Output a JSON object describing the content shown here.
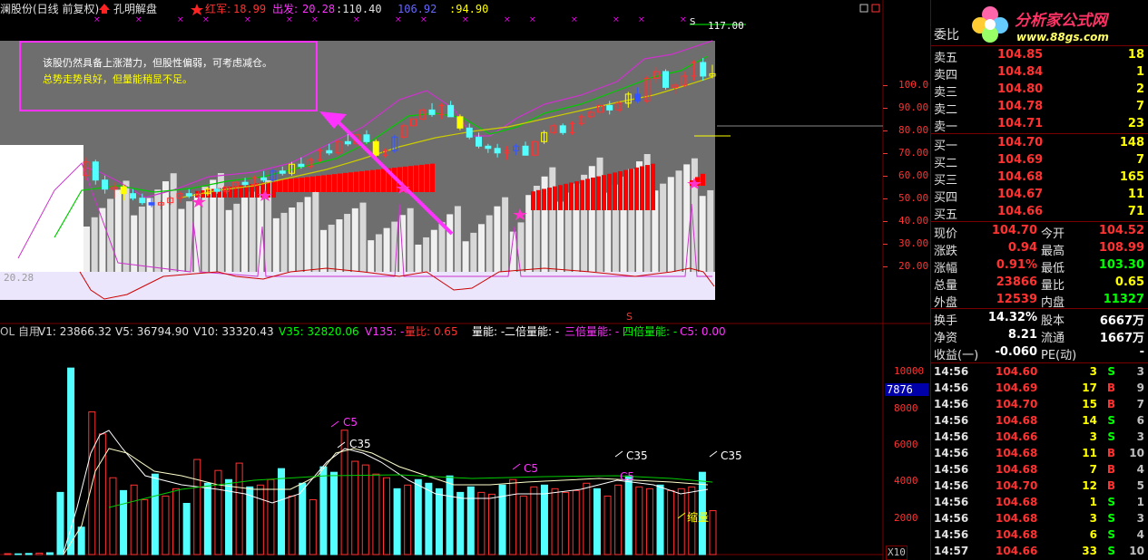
{
  "colors": {
    "up": "#ff3232",
    "down": "#54ffff",
    "yellow": "#ffff00",
    "green": "#00ff00",
    "magenta": "#ff00ff",
    "white": "#ffffff",
    "frame": "#7a0000"
  },
  "header": {
    "stock_name": "澜股份(日线 前复权)",
    "arrow_icon": "red-up-arrow-icon",
    "formula": "孔明解盘",
    "star_icon": "red-star-icon",
    "hongjun_label": "红军:",
    "hongjun_value": "18.99",
    "chufa_label": "出发:",
    "chufa_value": "20.28",
    "value_3": ":110.40",
    "value_4": "106.92",
    "value_5": ":94.90"
  },
  "annotation": {
    "line1": "该股仍然具备上涨潜力，但股性偏弱，可考虑减仓。",
    "line2": "总势走势良好，但量能稍显不足。"
  },
  "price_axis": [
    "100.0",
    "90.00",
    "80.00",
    "70.00",
    "60.00",
    "50.00",
    "40.00",
    "30.00",
    "20.00"
  ],
  "price_marks": {
    "top_price": "117.00",
    "s_mark": "S",
    "left_low": "20.28",
    "mid_s": "S"
  },
  "volume_header": {
    "prefix": "OL 自用",
    "v1": "V1: 23866.32",
    "v5": "V5: 36794.90",
    "v10": "V10: 33320.43",
    "v35": "V35: 32820.06",
    "v135": "V135: -",
    "liangbi": "量比: 0.65",
    "liangneng": "量能: -",
    "erbei": "二倍量能: -",
    "sanbei": "三倍量能: -",
    "sibei": "四倍量能: -",
    "c5": "C5: 0.00"
  },
  "volume_axis": [
    "10000",
    "8000",
    "6000",
    "4000",
    "2000"
  ],
  "volume_cursor": "7876",
  "volume_unit": "X10",
  "volume_labels": {
    "c5": "C5",
    "c35": "C35",
    "c5b": "C5",
    "suoliang": "缩量"
  },
  "logo": {
    "title": "分析家公式网",
    "url": "www.88gs.com"
  },
  "order_book": {
    "weibi_label": "委比",
    "asks": [
      {
        "label": "卖五",
        "price": "104.85",
        "vol": "18"
      },
      {
        "label": "卖四",
        "price": "104.84",
        "vol": "1"
      },
      {
        "label": "卖三",
        "price": "104.80",
        "vol": "2"
      },
      {
        "label": "卖二",
        "price": "104.78",
        "vol": "7"
      },
      {
        "label": "卖一",
        "price": "104.71",
        "vol": "23"
      }
    ],
    "bids": [
      {
        "label": "买一",
        "price": "104.70",
        "vol": "148"
      },
      {
        "label": "买二",
        "price": "104.69",
        "vol": "7"
      },
      {
        "label": "买三",
        "price": "104.68",
        "vol": "165"
      },
      {
        "label": "买四",
        "price": "104.67",
        "vol": "11"
      },
      {
        "label": "买五",
        "price": "104.66",
        "vol": "71"
      }
    ]
  },
  "stats": [
    {
      "l1": "现价",
      "v1": "104.70",
      "l2": "今开",
      "v2": "104.52"
    },
    {
      "l1": "涨跌",
      "v1": "0.94",
      "l2": "最高",
      "v2": "108.99"
    },
    {
      "l1": "涨幅",
      "v1": "0.91%",
      "l2": "最低",
      "v2": "103.30"
    },
    {
      "l1": "总量",
      "v1": "23866",
      "l2": "量比",
      "v2": "0.65"
    },
    {
      "l1": "外盘",
      "v1": "12539",
      "l2": "内盘",
      "v2": "11327"
    }
  ],
  "stats2": [
    {
      "l1": "换手",
      "v1": "14.32%",
      "l2": "股本",
      "v2": "6667万"
    },
    {
      "l1": "净资",
      "v1": "8.21",
      "l2": "流通",
      "v2": "1667万"
    },
    {
      "l1": "收益(一)",
      "v1": "-0.060",
      "l2": "PE(动)",
      "v2": "-"
    }
  ],
  "ticks": [
    {
      "time": "14:56",
      "price": "104.60",
      "vol": "3",
      "side": "S",
      "count": "3"
    },
    {
      "time": "14:56",
      "price": "104.69",
      "vol": "17",
      "side": "B",
      "count": "9"
    },
    {
      "time": "14:56",
      "price": "104.70",
      "vol": "15",
      "side": "B",
      "count": "7"
    },
    {
      "time": "14:56",
      "price": "104.68",
      "vol": "14",
      "side": "S",
      "count": "6"
    },
    {
      "time": "14:56",
      "price": "104.66",
      "vol": "3",
      "side": "S",
      "count": "3"
    },
    {
      "time": "14:56",
      "price": "104.68",
      "vol": "11",
      "side": "B",
      "count": "10"
    },
    {
      "time": "14:56",
      "price": "104.68",
      "vol": "7",
      "side": "B",
      "count": "4"
    },
    {
      "time": "14:56",
      "price": "104.70",
      "vol": "12",
      "side": "B",
      "count": "5"
    },
    {
      "time": "14:56",
      "price": "104.68",
      "vol": "1",
      "side": "S",
      "count": "1"
    },
    {
      "time": "14:56",
      "price": "104.68",
      "vol": "3",
      "side": "S",
      "count": "3"
    },
    {
      "time": "14:56",
      "price": "104.68",
      "vol": "6",
      "side": "S",
      "count": "4"
    },
    {
      "time": "14:57",
      "price": "104.66",
      "vol": "33",
      "side": "S",
      "count": "10"
    }
  ],
  "chart_data": {
    "type": "candlestick",
    "price_ylim": [
      15,
      120
    ],
    "volume_ylim": [
      0,
      11000
    ],
    "candles": [
      [
        60,
        68,
        58,
        66
      ],
      [
        66,
        67,
        56,
        58
      ],
      [
        58,
        60,
        52,
        54
      ],
      [
        54,
        57,
        50,
        55
      ],
      [
        55,
        56,
        49,
        52
      ],
      [
        52,
        54,
        49,
        50
      ],
      [
        50,
        52,
        47,
        48
      ],
      [
        48,
        50,
        46,
        47
      ],
      [
        47,
        49,
        45,
        48
      ],
      [
        48,
        51,
        47,
        50
      ],
      [
        50,
        53,
        48,
        52
      ],
      [
        52,
        54,
        50,
        51
      ],
      [
        51,
        53,
        49,
        52
      ],
      [
        52,
        55,
        51,
        54
      ],
      [
        54,
        56,
        52,
        53
      ],
      [
        53,
        56,
        52,
        55
      ],
      [
        55,
        58,
        54,
        57
      ],
      [
        57,
        59,
        55,
        56
      ],
      [
        56,
        60,
        55,
        59
      ],
      [
        59,
        62,
        57,
        58
      ],
      [
        58,
        63,
        57,
        62
      ],
      [
        62,
        64,
        60,
        61
      ],
      [
        61,
        66,
        60,
        65
      ],
      [
        65,
        68,
        63,
        64
      ],
      [
        64,
        68,
        63,
        67
      ],
      [
        67,
        72,
        66,
        71
      ],
      [
        71,
        74,
        69,
        70
      ],
      [
        70,
        76,
        69,
        75
      ],
      [
        75,
        79,
        73,
        74
      ],
      [
        74,
        80,
        72,
        78
      ],
      [
        78,
        80,
        74,
        75
      ],
      [
        75,
        76,
        68,
        69
      ],
      [
        69,
        72,
        68,
        71
      ],
      [
        71,
        78,
        70,
        77
      ],
      [
        77,
        83,
        76,
        82
      ],
      [
        82,
        86,
        80,
        85
      ],
      [
        85,
        90,
        84,
        89
      ],
      [
        89,
        92,
        86,
        87
      ],
      [
        87,
        92,
        85,
        91
      ],
      [
        91,
        93,
        88,
        86
      ],
      [
        86,
        87,
        80,
        81
      ],
      [
        81,
        83,
        76,
        77
      ],
      [
        77,
        79,
        72,
        73
      ],
      [
        73,
        74,
        70,
        72
      ],
      [
        72,
        74,
        68,
        70
      ],
      [
        70,
        73,
        67,
        71
      ],
      [
        71,
        74,
        69,
        73
      ],
      [
        73,
        75,
        70,
        69
      ],
      [
        69,
        76,
        68,
        75
      ],
      [
        75,
        80,
        74,
        79
      ],
      [
        79,
        83,
        78,
        82
      ],
      [
        82,
        83,
        78,
        79
      ],
      [
        79,
        84,
        78,
        83
      ],
      [
        83,
        87,
        82,
        86
      ],
      [
        86,
        89,
        85,
        88
      ],
      [
        88,
        92,
        86,
        91
      ],
      [
        91,
        93,
        87,
        89
      ],
      [
        89,
        93,
        88,
        92
      ],
      [
        92,
        97,
        90,
        96
      ],
      [
        96,
        99,
        92,
        93
      ],
      [
        93,
        104,
        92,
        103
      ],
      [
        103,
        108,
        101,
        106
      ],
      [
        106,
        107,
        98,
        99
      ],
      [
        99,
        101,
        96,
        100
      ],
      [
        100,
        106,
        99,
        104
      ],
      [
        104,
        111,
        102,
        110
      ],
      [
        110,
        112,
        102,
        104
      ],
      [
        104,
        109,
        103,
        105
      ]
    ],
    "volumes": [
      50,
      40,
      60,
      80,
      100,
      3400,
      10200,
      1500,
      7800,
      6600,
      4200,
      3500,
      3800,
      3000,
      4400,
      3200,
      3600,
      2800,
      5200,
      3900,
      4600,
      4100,
      5000,
      3700,
      3800,
      4100,
      4700,
      3200,
      3900,
      3000,
      4800,
      4500,
      6800,
      5100,
      4900,
      4400,
      4200,
      3600,
      3800,
      4100,
      3900,
      3600,
      4300,
      3400,
      3700,
      3400,
      3300,
      3800,
      4100,
      3200,
      3700,
      3800,
      3600,
      3400,
      3500,
      3900,
      3600,
      3200,
      3800,
      4300,
      3700,
      3600,
      3800,
      3500,
      3600,
      3700,
      4500,
      2400
    ]
  }
}
